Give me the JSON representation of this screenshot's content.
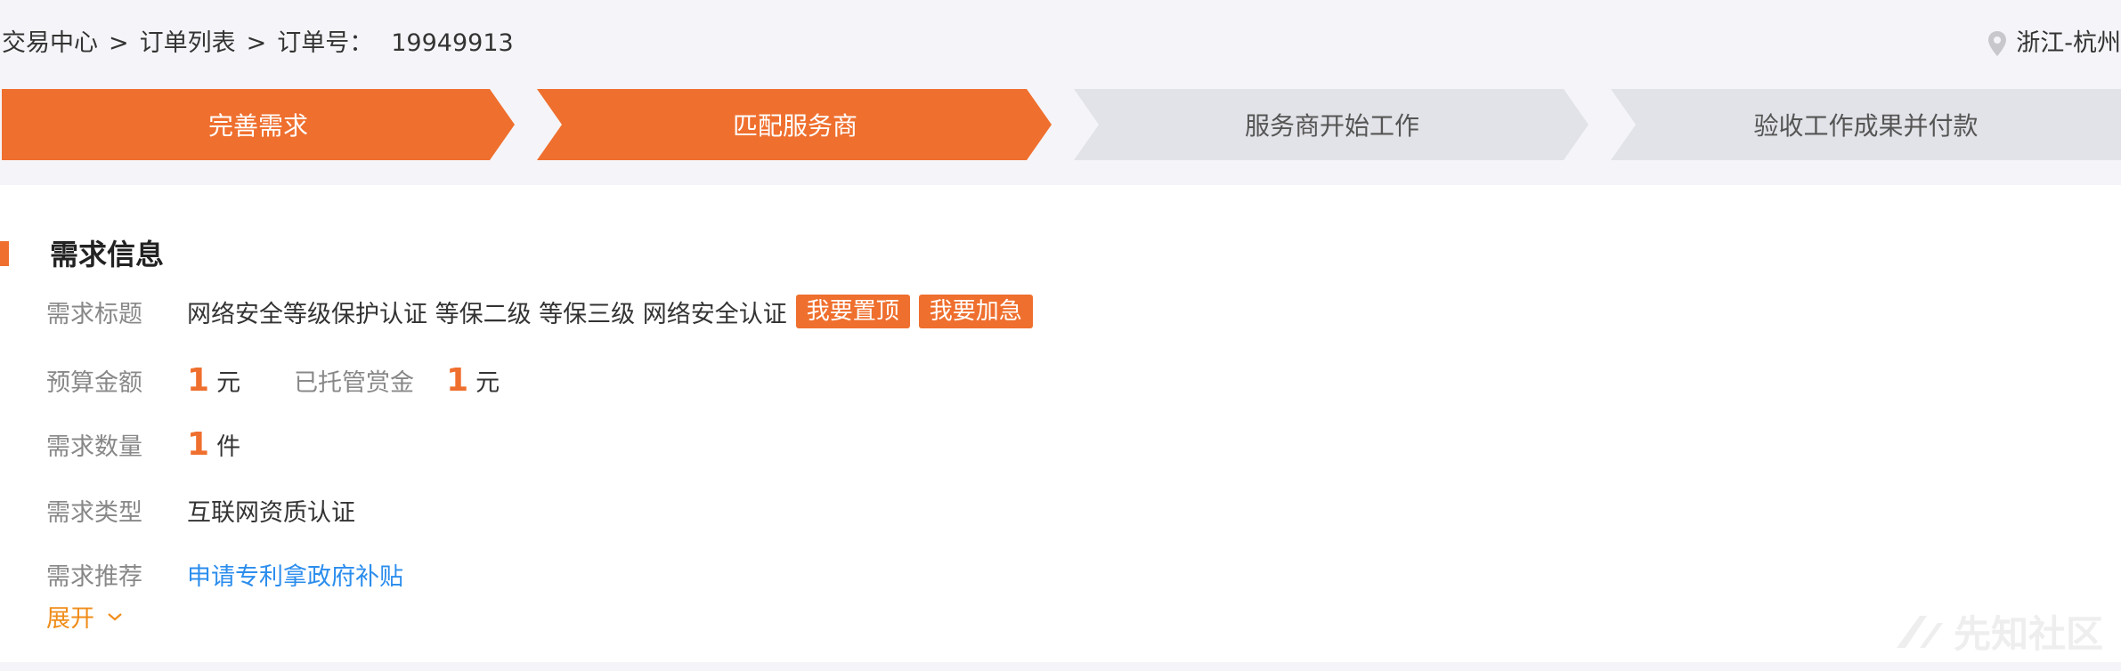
{
  "breadcrumb": {
    "items": [
      "交易中心",
      "订单列表",
      "订单号："
    ],
    "separator": ">",
    "order_no": "19949913"
  },
  "location": {
    "icon": "location-pin-icon",
    "text": "浙江-杭州"
  },
  "steps": [
    {
      "label": "完善需求",
      "state": "done"
    },
    {
      "label": "匹配服务商",
      "state": "current"
    },
    {
      "label": "服务商开始工作",
      "state": "pending"
    },
    {
      "label": "验收工作成果并付款",
      "state": "pending"
    }
  ],
  "section": {
    "title": "需求信息"
  },
  "fields": {
    "title": {
      "label": "需求标题",
      "value": "网络安全等级保护认证 等保二级 等保三级 网络安全认证",
      "pin_button": "我要置顶",
      "urgent_button": "我要加急"
    },
    "budget": {
      "label": "预算金额",
      "amount": "1",
      "unit": "元",
      "escrow_label": "已托管赏金",
      "escrow_amount": "1",
      "escrow_unit": "元"
    },
    "quantity": {
      "label": "需求数量",
      "amount": "1",
      "unit": "件"
    },
    "type": {
      "label": "需求类型",
      "value": "互联网资质认证"
    },
    "recommend": {
      "label": "需求推荐",
      "link": "申请专利拿政府补贴"
    }
  },
  "expand": {
    "label": "展开",
    "icon": "chevron-down-icon"
  },
  "watermark": {
    "text": "先知社区"
  },
  "colors": {
    "accent": "#ef6f2e",
    "inactive_step": "#e2e3e8",
    "link": "#2b8ded",
    "expand": "#f08c1a"
  }
}
